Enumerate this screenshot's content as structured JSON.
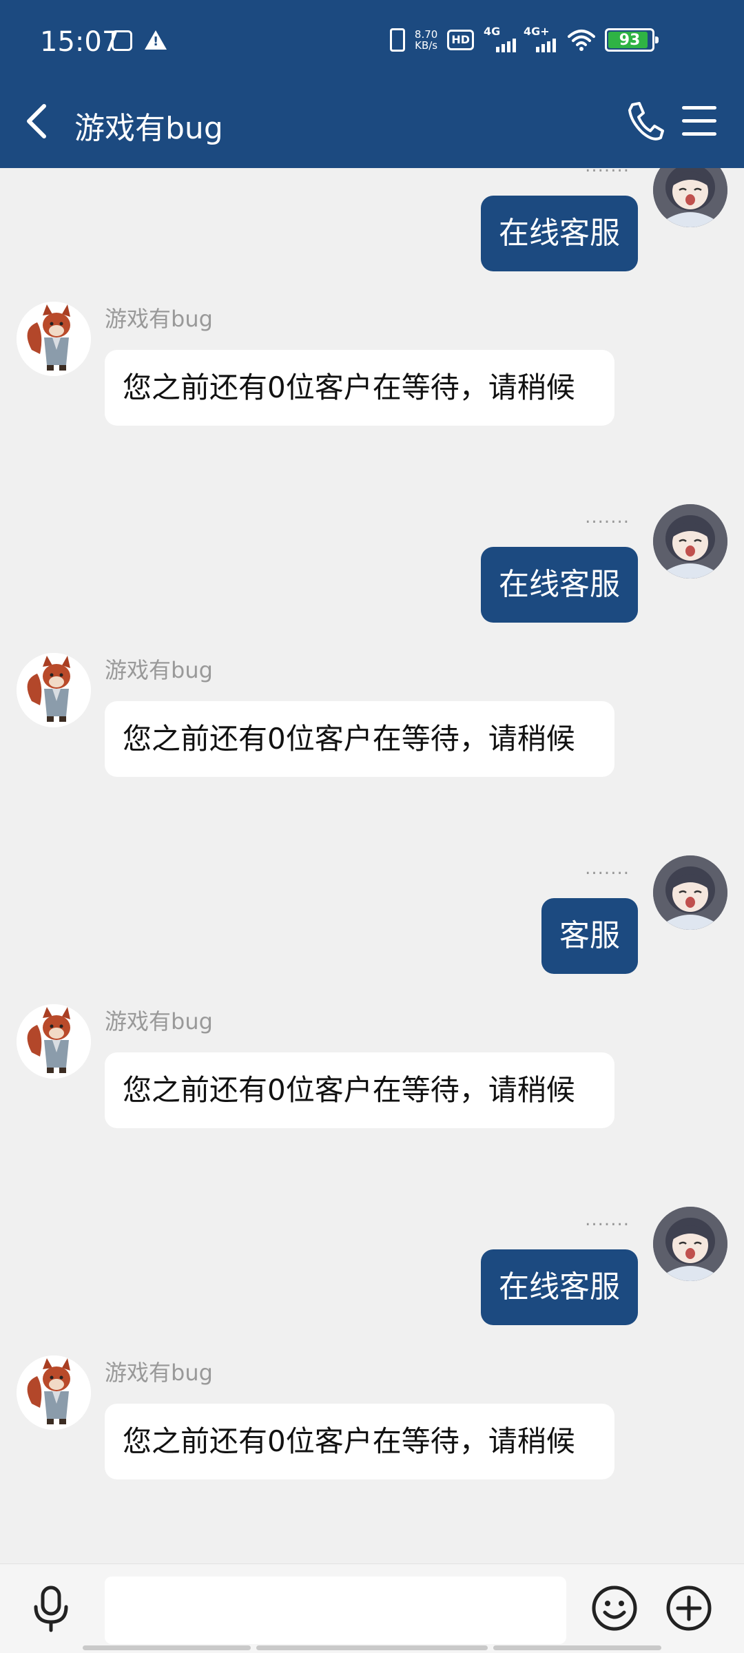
{
  "status": {
    "time": "15:07",
    "net_speed_value": "8.70",
    "net_speed_unit": "KB/s",
    "hd": "HD",
    "sim1": "4G",
    "sim2": "4G+",
    "battery": "93"
  },
  "header": {
    "title": "游戏有bug",
    "accent": "#1c4a80"
  },
  "messages": [
    {
      "side": "right",
      "text": "在线客服",
      "status": "......."
    },
    {
      "side": "left",
      "sender": "游戏有bug",
      "text": "您之前还有0位客户在等待，请稍候"
    },
    {
      "side": "right",
      "text": "在线客服",
      "status": "......."
    },
    {
      "side": "left",
      "sender": "游戏有bug",
      "text": "您之前还有0位客户在等待，请稍候"
    },
    {
      "side": "right",
      "text": "客服",
      "status": "......."
    },
    {
      "side": "left",
      "sender": "游戏有bug",
      "text": "您之前还有0位客户在等待，请稍候"
    },
    {
      "side": "right",
      "text": "在线客服",
      "status": "......."
    },
    {
      "side": "left",
      "sender": "游戏有bug",
      "text": "您之前还有0位客户在等待，请稍候"
    }
  ],
  "input": {
    "value": ""
  },
  "icons": {
    "back": "chevron-left-icon",
    "call": "phone-icon",
    "menu": "hamburger-menu-icon",
    "voice": "microphone-icon",
    "emoji": "smiley-icon",
    "more": "plus-circle-icon"
  }
}
